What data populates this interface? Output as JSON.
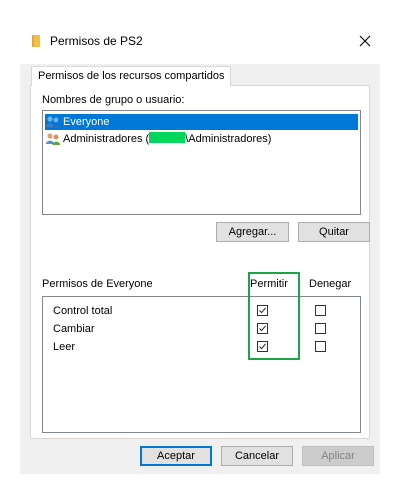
{
  "window": {
    "title": "Permisos de PS2",
    "close_icon": "close-icon",
    "folder_icon": "folder-icon"
  },
  "tab": {
    "label": "Permisos de los recursos compartidos"
  },
  "groups": {
    "label": "Nombres de grupo o usuario:",
    "items": [
      {
        "label": "Everyone",
        "selected": true
      },
      {
        "label_prefix": "Administradores (",
        "label_suffix": "\\Administradores)",
        "selected": false
      }
    ]
  },
  "buttons": {
    "add": "Agregar...",
    "remove": "Quitar",
    "ok": "Aceptar",
    "cancel": "Cancelar",
    "apply": "Aplicar"
  },
  "permissions": {
    "label": "Permisos de Everyone",
    "allow_header": "Permitir",
    "deny_header": "Denegar",
    "rows": [
      {
        "label": "Control total",
        "allow": true,
        "deny": false
      },
      {
        "label": "Cambiar",
        "allow": true,
        "deny": false
      },
      {
        "label": "Leer",
        "allow": true,
        "deny": false
      }
    ]
  },
  "colors": {
    "selection": "#0078d7",
    "redaction": "#00d65c",
    "highlight": "#1fa34a"
  }
}
